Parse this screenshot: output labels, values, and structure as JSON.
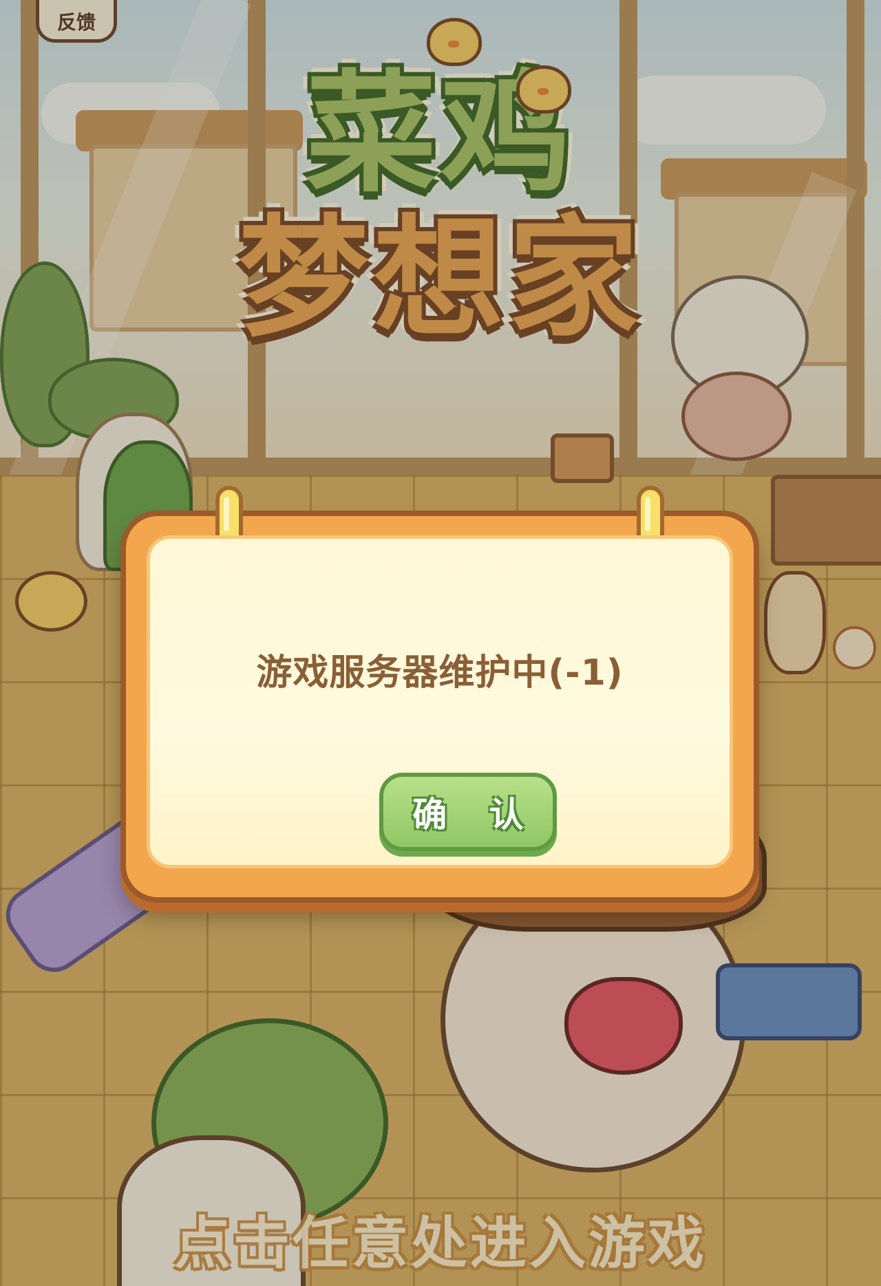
{
  "feedback_button": {
    "label": "反馈",
    "icon": "chick-icon"
  },
  "title_logo": {
    "line1": "菜鸡",
    "line2": "梦想家"
  },
  "dialog": {
    "message": "游戏服务器维护中(-1)",
    "confirm_label": "确 认"
  },
  "tap_hint": "点击任意处进入游戏",
  "colors": {
    "logo_green": "#a8c46e",
    "logo_orange": "#e9a758",
    "dialog_frame": "#f2a64d",
    "dialog_inner": "#fff7d6",
    "button_green": "#9ed274",
    "message_text": "#8a5e36"
  }
}
